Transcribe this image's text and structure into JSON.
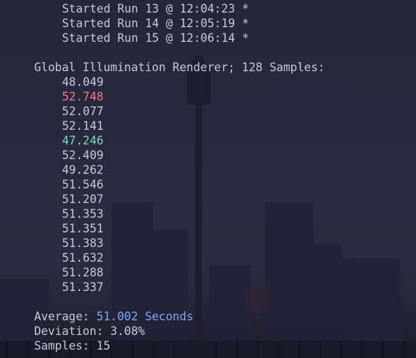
{
  "runs": [
    "Started Run 13 @ 12:04:23 *",
    "Started Run 14 @ 12:05:19 *",
    "Started Run 15 @ 12:06:14 *"
  ],
  "header": "Global Illumination Renderer; 128 Samples:",
  "samples": [
    {
      "value": "48.049",
      "status": "normal"
    },
    {
      "value": "52.748",
      "status": "max"
    },
    {
      "value": "52.077",
      "status": "normal"
    },
    {
      "value": "52.141",
      "status": "normal"
    },
    {
      "value": "47.246",
      "status": "min"
    },
    {
      "value": "52.409",
      "status": "normal"
    },
    {
      "value": "49.262",
      "status": "normal"
    },
    {
      "value": "51.546",
      "status": "normal"
    },
    {
      "value": "51.207",
      "status": "normal"
    },
    {
      "value": "51.353",
      "status": "normal"
    },
    {
      "value": "51.351",
      "status": "normal"
    },
    {
      "value": "51.383",
      "status": "normal"
    },
    {
      "value": "51.632",
      "status": "normal"
    },
    {
      "value": "51.288",
      "status": "normal"
    },
    {
      "value": "51.337",
      "status": "normal"
    }
  ],
  "summary": {
    "average_label": "Average: ",
    "average_value": "51.002 Seconds",
    "deviation": "Deviation: 3.08%",
    "samples": "Samples: 15"
  },
  "colors": {
    "max": "#f07b8a",
    "min": "#7fd9b8",
    "accent": "#86a6f2",
    "text": "#c9cbd8"
  }
}
